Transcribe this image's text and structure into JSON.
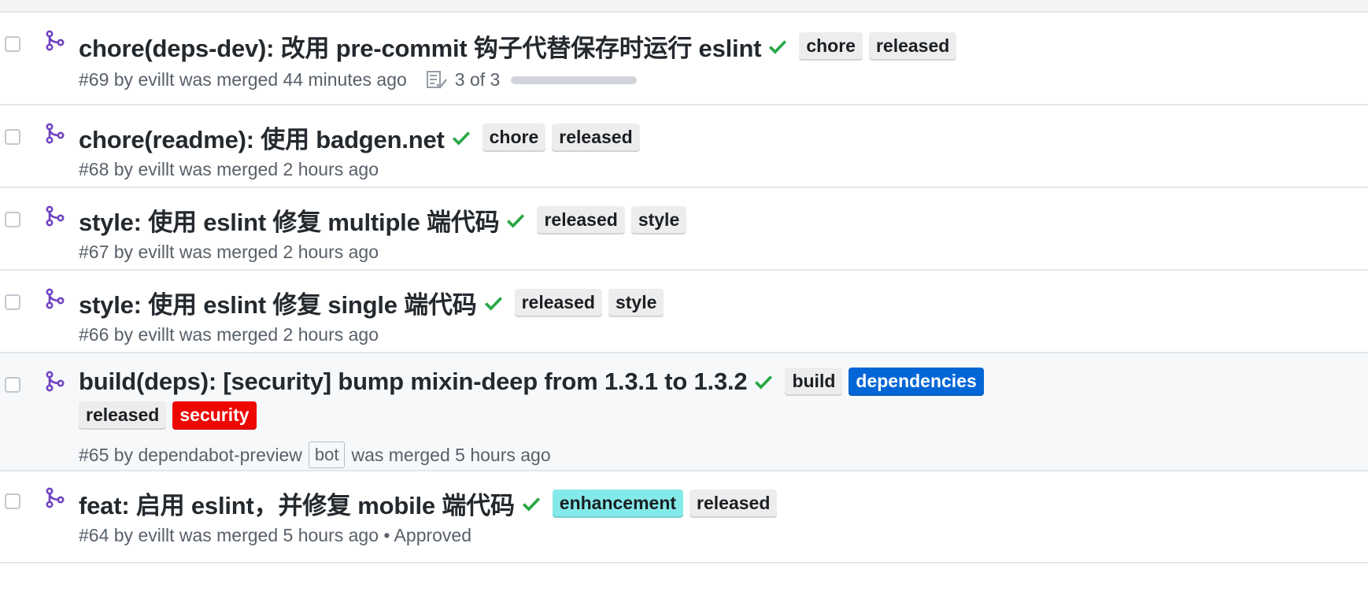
{
  "colors": {
    "merged_purple": "#6f42c1",
    "check_green": "#28a745",
    "label_default": "#ededed",
    "label_dependencies": "#0366d6",
    "label_security": "#ee0701",
    "label_enhancement": "#84e9e9"
  },
  "pull_requests": [
    {
      "title": "chore(deps-dev): 改用 pre-commit 钩子代替保存时运行 eslint",
      "status_icon": "check-icon",
      "labels": [
        "chore",
        "released"
      ],
      "meta": "#69 by evillt was merged 44 minutes ago",
      "tasks": {
        "icon": "task-list-icon",
        "text": "3 of 3",
        "progress": 1.0
      }
    },
    {
      "title": "chore(readme): 使用 badgen.net",
      "status_icon": "check-icon",
      "labels": [
        "chore",
        "released"
      ],
      "meta": "#68 by evillt was merged 2 hours ago"
    },
    {
      "title": "style: 使用 eslint 修复 multiple 端代码",
      "status_icon": "check-icon",
      "labels": [
        "released",
        "style"
      ],
      "meta": "#67 by evillt was merged 2 hours ago"
    },
    {
      "title": "style: 使用 eslint 修复 single 端代码",
      "status_icon": "check-icon",
      "labels": [
        "released",
        "style"
      ],
      "meta": "#66 by evillt was merged 2 hours ago"
    },
    {
      "title": "build(deps): [security] bump mixin-deep from 1.3.1 to 1.3.2",
      "status_icon": "check-icon",
      "labels": [
        "build",
        "dependencies",
        "released",
        "security"
      ],
      "meta_prefix": "#65 by dependabot-preview",
      "meta_badge": "bot",
      "meta_suffix": "was merged 5 hours ago"
    },
    {
      "title": "feat: 启用 eslint，并修复 mobile 端代码",
      "status_icon": "check-icon",
      "labels": [
        "enhancement",
        "released"
      ],
      "meta": "#64 by evillt was merged 5 hours ago • Approved"
    }
  ]
}
